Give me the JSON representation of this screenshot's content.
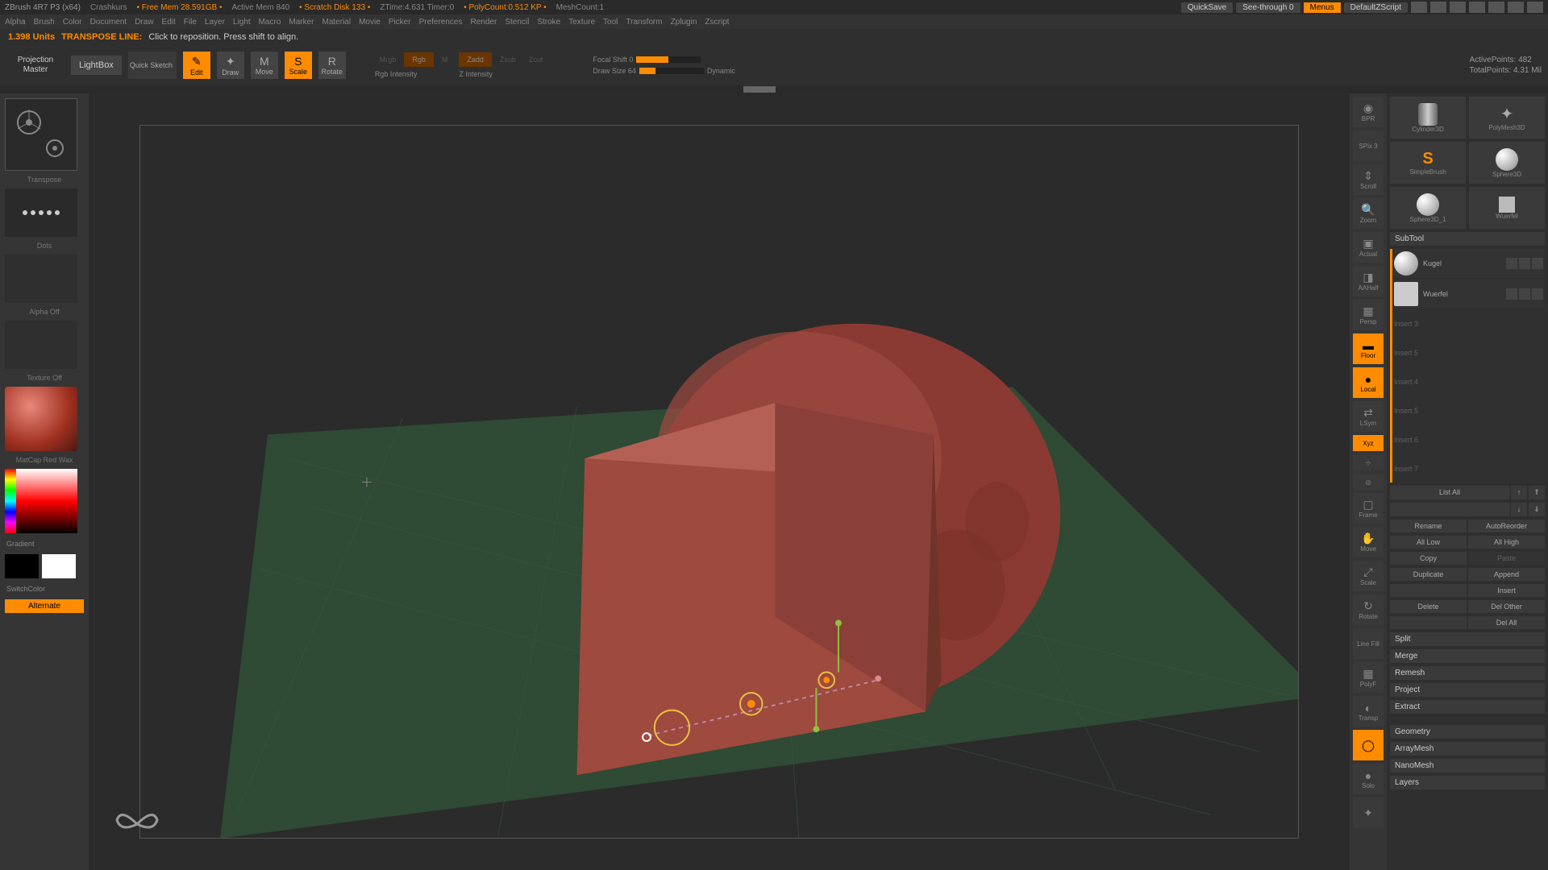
{
  "titlebar": {
    "app": "ZBrush 4R7 P3 (x64)",
    "project": "Crashkurs",
    "free_mem": "• Free Mem 28.591GB •",
    "active_mem": "Active Mem 840",
    "scratch": "• Scratch Disk 133 •",
    "ztime": "ZTime:4.631  Timer:0",
    "polycount": "• PolyCount:0.512 KP •",
    "meshcount": "MeshCount:1",
    "quicksave": "QuickSave",
    "seethrough": "See-through  0",
    "menus": "Menus",
    "zscript": "DefaultZScript"
  },
  "menubar": {
    "items": [
      "Alpha",
      "Brush",
      "Color",
      "Document",
      "Draw",
      "Edit",
      "File",
      "Layer",
      "Light",
      "Macro",
      "Marker",
      "Material",
      "Movie",
      "Picker",
      "Preferences",
      "Render",
      "Stencil",
      "Stroke",
      "Texture",
      "Tool",
      "Transform",
      "Zplugin",
      "Zscript"
    ]
  },
  "statusline": {
    "units": "1.398 Units",
    "mode": "TRANSPOSE LINE:",
    "hint": "Click to reposition. Press shift to align."
  },
  "toolbar": {
    "projection": "Projection Master",
    "lightbox": "LightBox",
    "quick_sketch": "Quick Sketch",
    "edit": "Edit",
    "draw": "Draw",
    "move": "Move",
    "scale": "Scale",
    "rotate": "Rotate",
    "mrgb": "Mrgb",
    "rgb": "Rgb",
    "m": "M",
    "rgb_intensity": "Rgb Intensity",
    "zadd": "Zadd",
    "zsub": "Zsub",
    "zcut": "Zcut",
    "z_intensity": "Z Intensity",
    "focal_shift": "Focal Shift 0",
    "draw_size": "Draw Size 64",
    "dynamic": "Dynamic",
    "active_points": "ActivePoints: 482",
    "total_points": "TotalPoints: 4.31 Mil"
  },
  "left": {
    "transpose": "Transpose",
    "dots": "Dots",
    "alpha_off": "Alpha Off",
    "texture_off": "Texture Off",
    "material": "MatCap Red Wax",
    "gradient": "Gradient",
    "switchcolor": "SwitchColor",
    "alternate": "Alternate"
  },
  "right_tools": {
    "bpr": "BPR",
    "spix": "SPix 3",
    "scroll": "Scroll",
    "zoom": "Zoom",
    "actual": "Actual",
    "aahalf": "AAHalf",
    "persp": "Persp",
    "floor": "Floor",
    "local": "Local",
    "lsym": "LSym",
    "xyz": "Xyz",
    "frame": "Frame",
    "move": "Move",
    "scale": "Scale",
    "rotate": "Rotate",
    "linefill": "Line Fill",
    "polyf": "PolyF",
    "transp": "Transp",
    "ghost": "Ghost",
    "solo": "Solo",
    "dynamic": "Dynamic"
  },
  "tools": {
    "cylinder": "Cylinder3D",
    "polymesh": "PolyMesh3D",
    "simplebrush": "SimpleBrush",
    "sphere3d": "Sphere3D",
    "sphere3d_1": "Sphere3D_1",
    "wuerfel": "Wuerfel"
  },
  "subtool": {
    "header": "SubTool",
    "items": [
      {
        "name": "Kugel"
      },
      {
        "name": "Wuerfel"
      },
      {
        "name": "Insert 3"
      },
      {
        "name": "Insert 5"
      },
      {
        "name": "Insert 4"
      },
      {
        "name": "Insert 5"
      },
      {
        "name": "Insert 6"
      },
      {
        "name": "Insert 7"
      }
    ],
    "list_all": "List All",
    "rename": "Rename",
    "autoreorder": "AutoReorder",
    "all_low": "All Low",
    "all_high": "All High",
    "copy": "Copy",
    "paste": "Paste",
    "duplicate": "Duplicate",
    "append": "Append",
    "insert": "Insert",
    "delete": "Delete",
    "del_other": "Del Other",
    "del_all": "Del All",
    "split": "Split",
    "merge": "Merge",
    "remesh": "Remesh",
    "project": "Project",
    "extract": "Extract",
    "geometry": "Geometry",
    "arraymesh": "ArrayMesh",
    "nanomesh": "NanoMesh",
    "layers": "Layers"
  }
}
